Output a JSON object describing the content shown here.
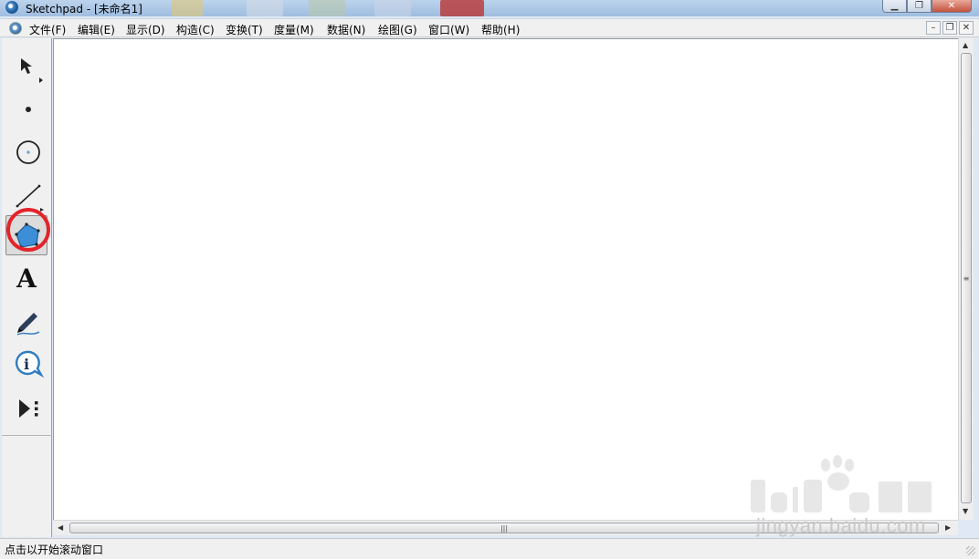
{
  "window": {
    "title": "Sketchpad  - [未命名1]"
  },
  "menu": {
    "items": [
      {
        "label": "文件(F)"
      },
      {
        "label": "编辑(E)"
      },
      {
        "label": "显示(D)"
      },
      {
        "label": "构造(C)"
      },
      {
        "label": "变换(T)"
      },
      {
        "label": "度量(M)"
      },
      {
        "label": "数据(N)"
      },
      {
        "label": "绘图(G)"
      },
      {
        "label": "窗口(W)"
      },
      {
        "label": "帮助(H)"
      }
    ]
  },
  "toolbox": {
    "tools": [
      {
        "icon": "arrow-select-icon",
        "active": false
      },
      {
        "icon": "point-icon",
        "active": false
      },
      {
        "icon": "compass-circle-icon",
        "active": false
      },
      {
        "icon": "straightedge-icon",
        "active": false
      },
      {
        "icon": "polygon-icon",
        "active": true,
        "highlighted": true
      },
      {
        "icon": "text-icon",
        "label": "A",
        "active": false
      },
      {
        "icon": "marker-icon",
        "active": false
      },
      {
        "icon": "information-icon",
        "label": "i",
        "active": false
      },
      {
        "icon": "custom-tools-icon",
        "active": false
      }
    ]
  },
  "status": {
    "text": "点击以开始滚动窗口"
  },
  "watermark": {
    "url": "jingyan.baidu.com"
  },
  "colors": {
    "highlight": "#e5232b",
    "polygon_fill": "#3c8fd6"
  }
}
